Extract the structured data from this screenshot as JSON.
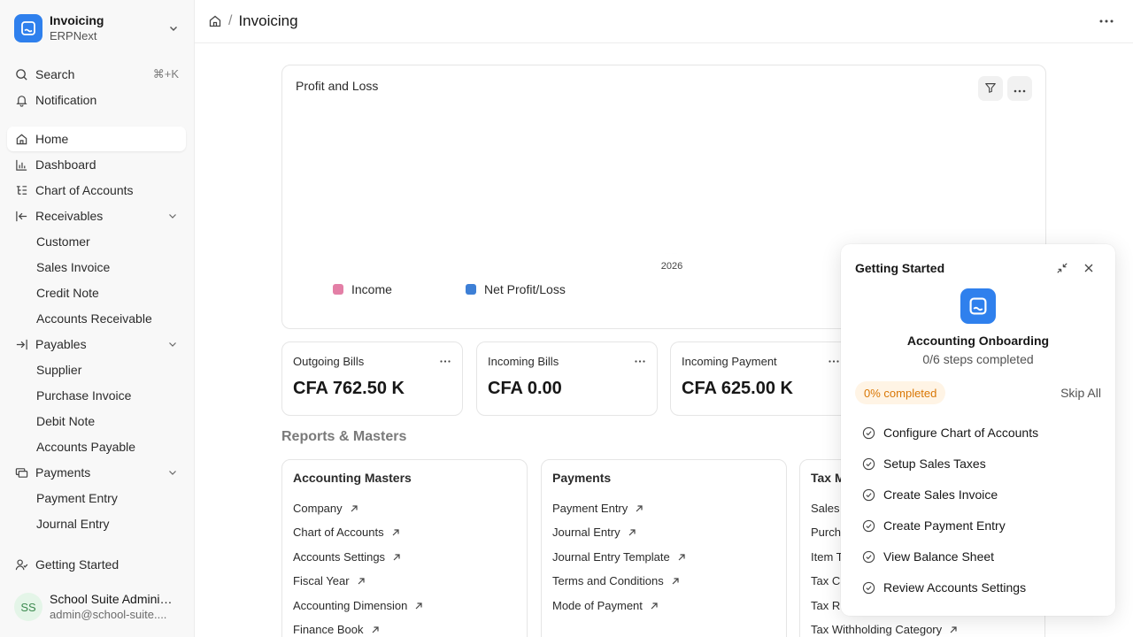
{
  "app": {
    "title": "Invoicing",
    "subtitle": "ERPNext"
  },
  "sidebar": {
    "search_label": "Search",
    "search_shortcut": "⌘+K",
    "notification_label": "Notification",
    "items": [
      {
        "label": "Home"
      },
      {
        "label": "Dashboard"
      },
      {
        "label": "Chart of Accounts"
      },
      {
        "label": "Receivables"
      },
      {
        "label": "Customer"
      },
      {
        "label": "Sales Invoice"
      },
      {
        "label": "Credit Note"
      },
      {
        "label": "Accounts Receivable"
      },
      {
        "label": "Payables"
      },
      {
        "label": "Supplier"
      },
      {
        "label": "Purchase Invoice"
      },
      {
        "label": "Debit Note"
      },
      {
        "label": "Accounts Payable"
      },
      {
        "label": "Payments"
      },
      {
        "label": "Payment Entry"
      },
      {
        "label": "Journal Entry"
      }
    ],
    "getting_started_label": "Getting Started",
    "user": {
      "initials": "SS",
      "name": "School Suite Adminis...",
      "email": "admin@school-suite...."
    }
  },
  "header": {
    "title": "Invoicing"
  },
  "chart": {
    "title": "Profit and Loss",
    "legend": [
      {
        "label": "Income",
        "color": "#e37fa6"
      },
      {
        "label": "Net Profit/Loss",
        "color": "#3d7fd6"
      }
    ]
  },
  "chart_data": {
    "type": "bar",
    "categories": [
      "2026"
    ],
    "series": [
      {
        "name": "Income",
        "values": [
          0
        ]
      },
      {
        "name": "Net Profit/Loss",
        "values": [
          0
        ]
      }
    ],
    "title": "Profit and Loss",
    "xlabel": "",
    "ylabel": "",
    "legend": "bottom-left",
    "grid": false
  },
  "stats": [
    {
      "label": "Outgoing Bills",
      "value": "CFA 762.50 K"
    },
    {
      "label": "Incoming Bills",
      "value": "CFA 0.00"
    },
    {
      "label": "Incoming Payment",
      "value": "CFA 625.00 K"
    }
  ],
  "section": {
    "title": "Reports & Masters"
  },
  "cards": [
    {
      "title": "Accounting Masters",
      "links": [
        "Company",
        "Chart of Accounts",
        "Accounts Settings",
        "Fiscal Year",
        "Accounting Dimension",
        "Finance Book"
      ]
    },
    {
      "title": "Payments",
      "links": [
        "Payment Entry",
        "Journal Entry",
        "Journal Entry Template",
        "Terms and Conditions",
        "Mode of Payment"
      ]
    },
    {
      "title": "Tax M",
      "links": [
        "Sales",
        "Purch",
        "Item T",
        "Tax C",
        "Tax R",
        "Tax Withholding Category"
      ]
    }
  ],
  "onboarding": {
    "title": "Getting Started",
    "heading": "Accounting Onboarding",
    "steps_text": "0/6 steps completed",
    "progress_label": "0% completed",
    "progress_value": 0,
    "skip_label": "Skip All",
    "steps": [
      "Configure Chart of Accounts",
      "Setup Sales Taxes",
      "Create Sales Invoice",
      "Create Payment Entry",
      "View Balance Sheet",
      "Review Accounts Settings"
    ]
  },
  "colors": {
    "brand": "#2f80ed",
    "badge_bg": "#fff4e5",
    "badge_text": "#d97706"
  }
}
